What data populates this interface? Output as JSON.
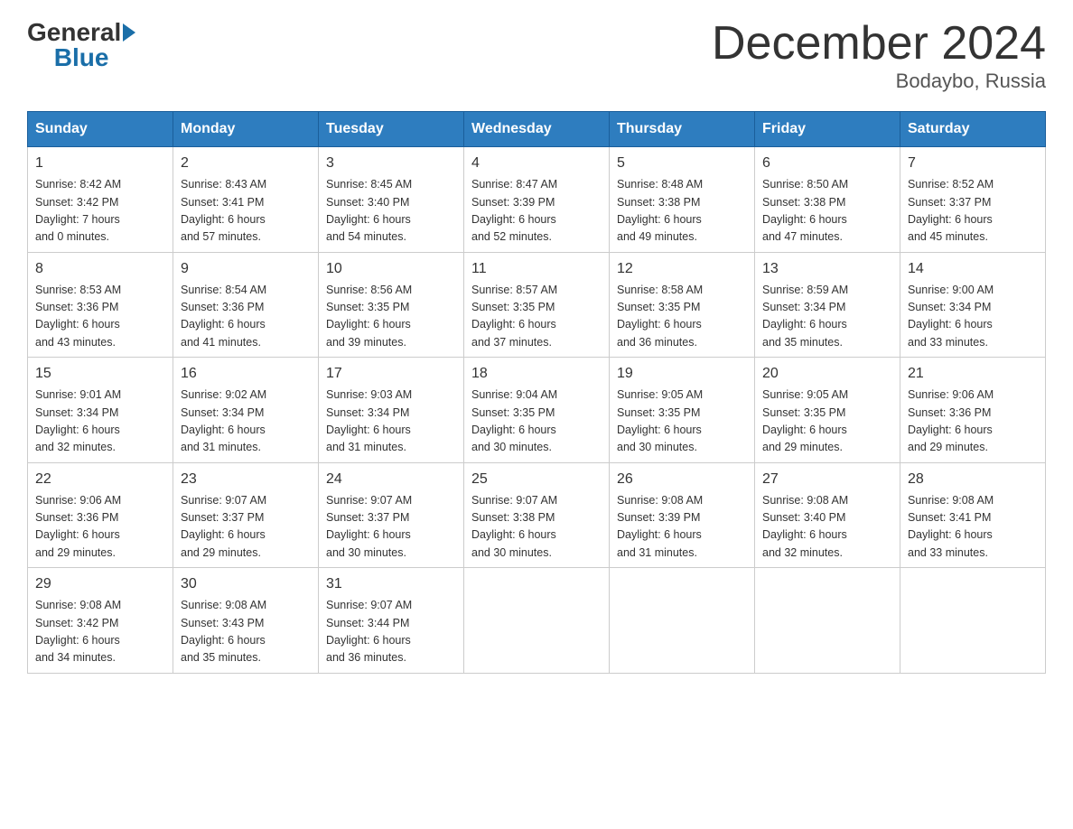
{
  "header": {
    "logo_general": "General",
    "logo_blue": "Blue",
    "month_title": "December 2024",
    "location": "Bodaybo, Russia"
  },
  "weekdays": [
    "Sunday",
    "Monday",
    "Tuesday",
    "Wednesday",
    "Thursday",
    "Friday",
    "Saturday"
  ],
  "weeks": [
    [
      {
        "day": "1",
        "sunrise": "8:42 AM",
        "sunset": "3:42 PM",
        "daylight": "7 hours and 0 minutes."
      },
      {
        "day": "2",
        "sunrise": "8:43 AM",
        "sunset": "3:41 PM",
        "daylight": "6 hours and 57 minutes."
      },
      {
        "day": "3",
        "sunrise": "8:45 AM",
        "sunset": "3:40 PM",
        "daylight": "6 hours and 54 minutes."
      },
      {
        "day": "4",
        "sunrise": "8:47 AM",
        "sunset": "3:39 PM",
        "daylight": "6 hours and 52 minutes."
      },
      {
        "day": "5",
        "sunrise": "8:48 AM",
        "sunset": "3:38 PM",
        "daylight": "6 hours and 49 minutes."
      },
      {
        "day": "6",
        "sunrise": "8:50 AM",
        "sunset": "3:38 PM",
        "daylight": "6 hours and 47 minutes."
      },
      {
        "day": "7",
        "sunrise": "8:52 AM",
        "sunset": "3:37 PM",
        "daylight": "6 hours and 45 minutes."
      }
    ],
    [
      {
        "day": "8",
        "sunrise": "8:53 AM",
        "sunset": "3:36 PM",
        "daylight": "6 hours and 43 minutes."
      },
      {
        "day": "9",
        "sunrise": "8:54 AM",
        "sunset": "3:36 PM",
        "daylight": "6 hours and 41 minutes."
      },
      {
        "day": "10",
        "sunrise": "8:56 AM",
        "sunset": "3:35 PM",
        "daylight": "6 hours and 39 minutes."
      },
      {
        "day": "11",
        "sunrise": "8:57 AM",
        "sunset": "3:35 PM",
        "daylight": "6 hours and 37 minutes."
      },
      {
        "day": "12",
        "sunrise": "8:58 AM",
        "sunset": "3:35 PM",
        "daylight": "6 hours and 36 minutes."
      },
      {
        "day": "13",
        "sunrise": "8:59 AM",
        "sunset": "3:34 PM",
        "daylight": "6 hours and 35 minutes."
      },
      {
        "day": "14",
        "sunrise": "9:00 AM",
        "sunset": "3:34 PM",
        "daylight": "6 hours and 33 minutes."
      }
    ],
    [
      {
        "day": "15",
        "sunrise": "9:01 AM",
        "sunset": "3:34 PM",
        "daylight": "6 hours and 32 minutes."
      },
      {
        "day": "16",
        "sunrise": "9:02 AM",
        "sunset": "3:34 PM",
        "daylight": "6 hours and 31 minutes."
      },
      {
        "day": "17",
        "sunrise": "9:03 AM",
        "sunset": "3:34 PM",
        "daylight": "6 hours and 31 minutes."
      },
      {
        "day": "18",
        "sunrise": "9:04 AM",
        "sunset": "3:35 PM",
        "daylight": "6 hours and 30 minutes."
      },
      {
        "day": "19",
        "sunrise": "9:05 AM",
        "sunset": "3:35 PM",
        "daylight": "6 hours and 30 minutes."
      },
      {
        "day": "20",
        "sunrise": "9:05 AM",
        "sunset": "3:35 PM",
        "daylight": "6 hours and 29 minutes."
      },
      {
        "day": "21",
        "sunrise": "9:06 AM",
        "sunset": "3:36 PM",
        "daylight": "6 hours and 29 minutes."
      }
    ],
    [
      {
        "day": "22",
        "sunrise": "9:06 AM",
        "sunset": "3:36 PM",
        "daylight": "6 hours and 29 minutes."
      },
      {
        "day": "23",
        "sunrise": "9:07 AM",
        "sunset": "3:37 PM",
        "daylight": "6 hours and 29 minutes."
      },
      {
        "day": "24",
        "sunrise": "9:07 AM",
        "sunset": "3:37 PM",
        "daylight": "6 hours and 30 minutes."
      },
      {
        "day": "25",
        "sunrise": "9:07 AM",
        "sunset": "3:38 PM",
        "daylight": "6 hours and 30 minutes."
      },
      {
        "day": "26",
        "sunrise": "9:08 AM",
        "sunset": "3:39 PM",
        "daylight": "6 hours and 31 minutes."
      },
      {
        "day": "27",
        "sunrise": "9:08 AM",
        "sunset": "3:40 PM",
        "daylight": "6 hours and 32 minutes."
      },
      {
        "day": "28",
        "sunrise": "9:08 AM",
        "sunset": "3:41 PM",
        "daylight": "6 hours and 33 minutes."
      }
    ],
    [
      {
        "day": "29",
        "sunrise": "9:08 AM",
        "sunset": "3:42 PM",
        "daylight": "6 hours and 34 minutes."
      },
      {
        "day": "30",
        "sunrise": "9:08 AM",
        "sunset": "3:43 PM",
        "daylight": "6 hours and 35 minutes."
      },
      {
        "day": "31",
        "sunrise": "9:07 AM",
        "sunset": "3:44 PM",
        "daylight": "6 hours and 36 minutes."
      },
      null,
      null,
      null,
      null
    ]
  ]
}
